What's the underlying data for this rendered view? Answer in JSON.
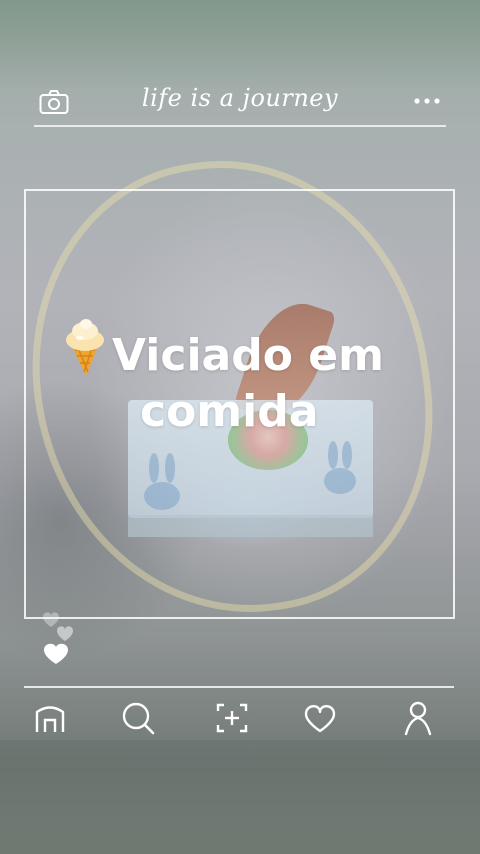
{
  "header": {
    "title": "life is a journey",
    "left_icon": "camera-icon",
    "right_icon": "more-icon"
  },
  "post": {
    "caption_line1": "Viciado em",
    "caption_line2": "comida",
    "caption_emoji": "ice-cream-icon"
  },
  "reactions": {
    "icons": [
      "heart-icon",
      "heart-icon",
      "heart-icon"
    ]
  },
  "bottom_nav": {
    "items": [
      "home-icon",
      "search-icon",
      "add-post-icon",
      "likes-icon",
      "profile-icon"
    ]
  },
  "colors": {
    "overlay_text": "#ffffff",
    "frame_lines": "#ffffff"
  }
}
